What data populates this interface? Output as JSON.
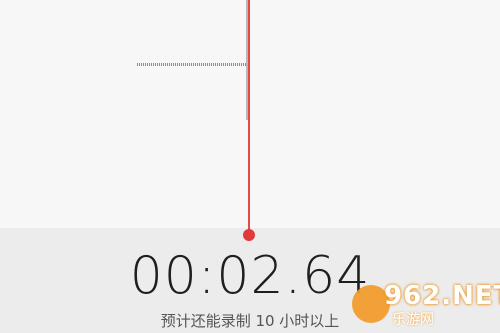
{
  "recorder": {
    "elapsed_time": "00:02.64",
    "remaining_hint": "预计还能录制 10 小时以上"
  },
  "watermark": {
    "brand": "962.NET",
    "tagline": "乐游网"
  },
  "colors": {
    "playhead": "#e3484a",
    "waveform": "#8d8d8d",
    "watermark_orange": "#f29a28"
  }
}
